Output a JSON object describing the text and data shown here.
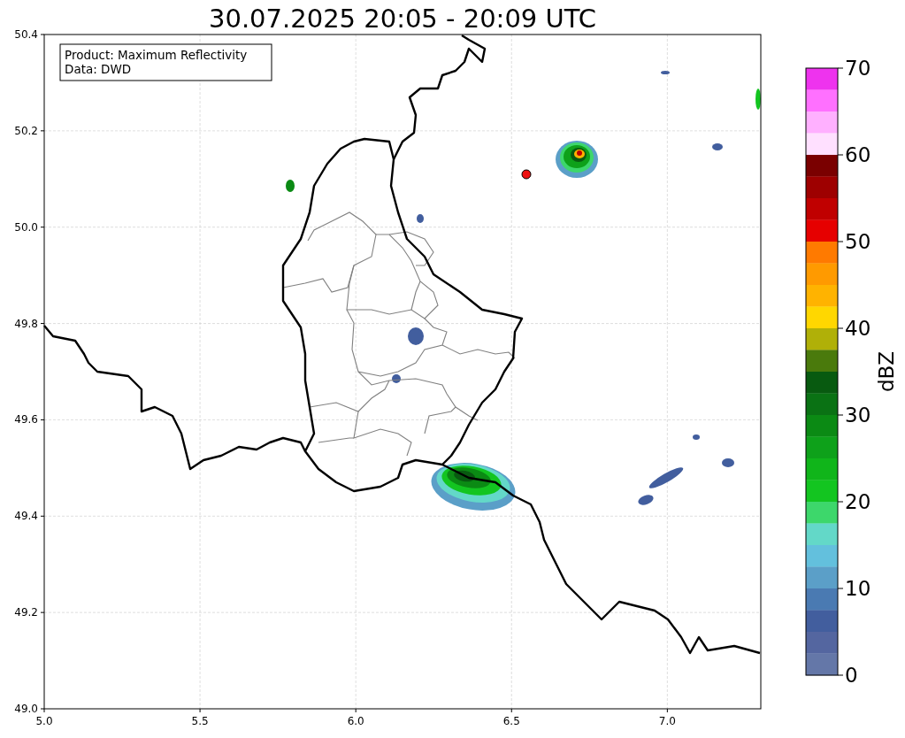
{
  "title": "30.07.2025 20:05 - 20:09 UTC",
  "info_box": {
    "lines": [
      "Product: Maximum Reflectivity",
      "Data: DWD"
    ]
  },
  "map": {
    "xticks": [
      "5.0",
      "5.5",
      "6.0",
      "6.5",
      "7.0"
    ],
    "yticks": [
      "50.4",
      "50.2",
      "50.0",
      "49.8",
      "49.6",
      "49.4",
      "49.2",
      "49.0"
    ]
  },
  "colorbar": {
    "label": "dBZ",
    "ticks": [
      "70",
      "60",
      "50",
      "40",
      "30",
      "20",
      "10",
      "0"
    ],
    "bins": [
      {
        "color": "#ee33ee"
      },
      {
        "color": "#ff70ff"
      },
      {
        "color": "#ffb0ff"
      },
      {
        "color": "#ffe0ff"
      },
      {
        "color": "#7a0000"
      },
      {
        "color": "#9e0000"
      },
      {
        "color": "#c00000"
      },
      {
        "color": "#e60000"
      },
      {
        "color": "#ff7a00"
      },
      {
        "color": "#ff9a00"
      },
      {
        "color": "#ffb300"
      },
      {
        "color": "#ffd700"
      },
      {
        "color": "#b0b008"
      },
      {
        "color": "#4a7a0c"
      },
      {
        "color": "#085a10"
      },
      {
        "color": "#0a7214"
      },
      {
        "color": "#0b8a14"
      },
      {
        "color": "#0ea11a"
      },
      {
        "color": "#10b51a"
      },
      {
        "color": "#13c520"
      },
      {
        "color": "#3dd76b"
      },
      {
        "color": "#63d8c8"
      },
      {
        "color": "#63c0dd"
      },
      {
        "color": "#5b9fc8"
      },
      {
        "color": "#4a7ab2"
      },
      {
        "color": "#425e9e"
      },
      {
        "color": "#5466a0"
      },
      {
        "color": "#6477a8"
      }
    ]
  }
}
